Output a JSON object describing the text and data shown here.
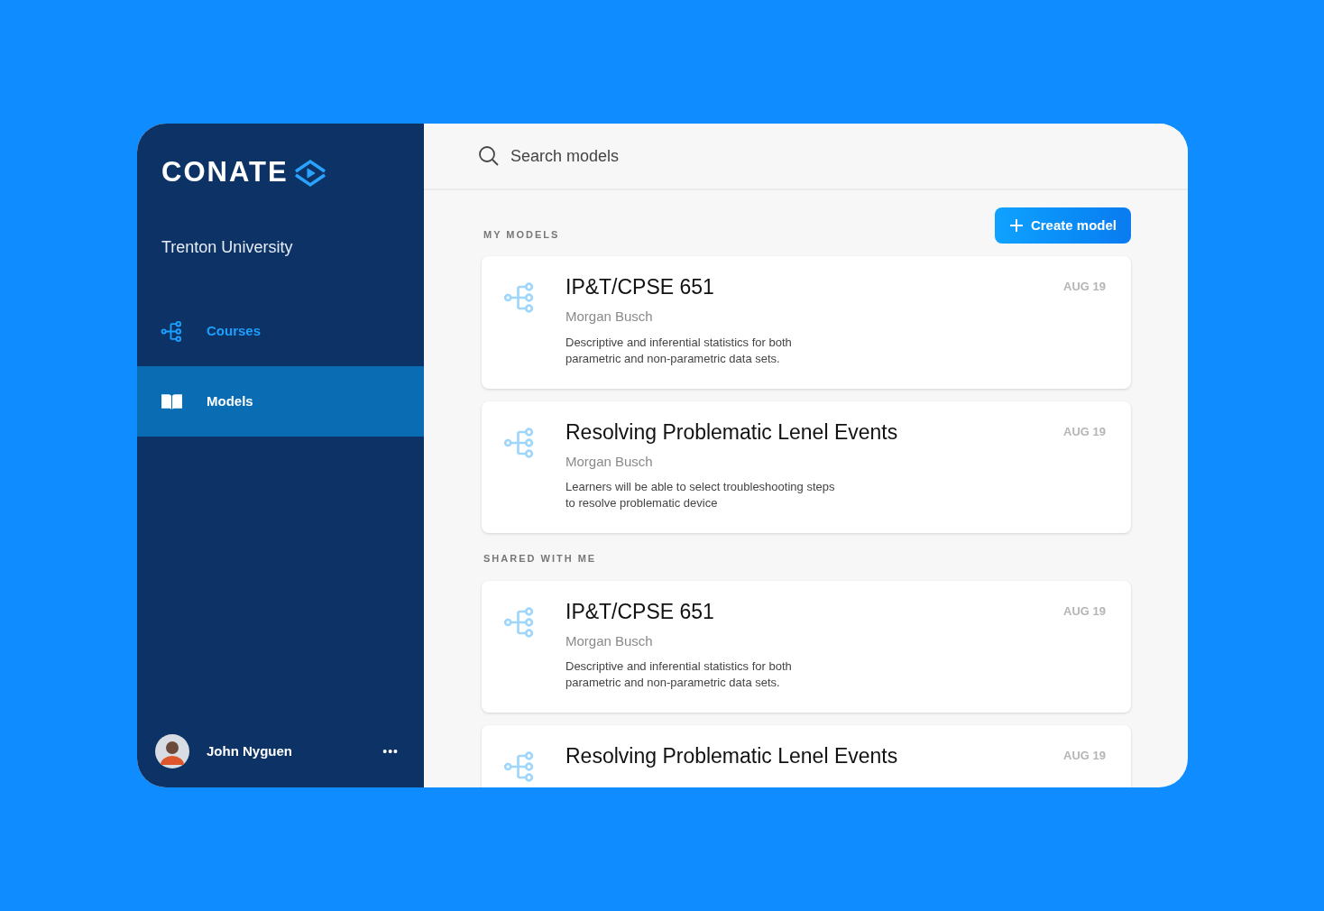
{
  "brand": {
    "name": "CONATE"
  },
  "sidebar": {
    "organization": "Trenton University",
    "items": [
      {
        "label": "Courses",
        "kind": "tree",
        "selected": false
      },
      {
        "label": "Models",
        "kind": "book",
        "selected": true
      }
    ],
    "user": {
      "name": "John Nyguen",
      "menu": "•••"
    }
  },
  "search": {
    "placeholder": "Search models"
  },
  "create_button": {
    "label": "Create model"
  },
  "sections": [
    {
      "title": "MY MODELS",
      "cards": [
        {
          "title": "IP&T/CPSE 651",
          "author": "Morgan Busch",
          "description": "Descriptive and inferential statistics for both parametric and non-parametric data sets.",
          "date": "AUG 19"
        },
        {
          "title": "Resolving Problematic Lenel Events",
          "author": "Morgan Busch",
          "description": "Learners will be able to select troubleshooting steps to resolve problematic device",
          "date": "AUG 19"
        }
      ]
    },
    {
      "title": "SHARED WITH ME",
      "cards": [
        {
          "title": "IP&T/CPSE 651",
          "author": "Morgan Busch",
          "description": "Descriptive and inferential statistics for both parametric and non-parametric data sets.",
          "date": "AUG 19"
        },
        {
          "title": "Resolving Problematic Lenel Events",
          "date": "AUG 19"
        }
      ]
    }
  ]
}
